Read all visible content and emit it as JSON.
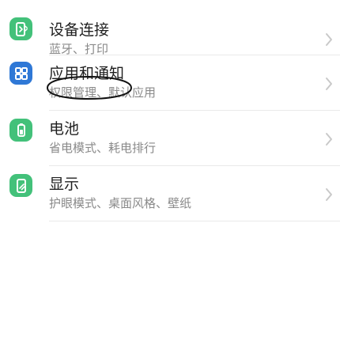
{
  "settings": {
    "items": [
      {
        "title": "设备连接",
        "subtitle": "蓝牙、打印",
        "icon": "device-connection-icon",
        "icon_color": "#43c17a"
      },
      {
        "title": "应用和通知",
        "subtitle": "权限管理、默认应用",
        "icon": "apps-grid-icon",
        "icon_color": "#2f78d6"
      },
      {
        "title": "电池",
        "subtitle": "省电模式、耗电排行",
        "icon": "battery-icon",
        "icon_color": "#43c17a"
      },
      {
        "title": "显示",
        "subtitle": "护眼模式、桌面风格、壁纸",
        "icon": "display-icon",
        "icon_color": "#43c17a"
      }
    ]
  },
  "colors": {
    "green": "#43c17a",
    "blue": "#2f78d6",
    "title_text": "#1f1f1f",
    "subtitle_text": "#8a8a8a",
    "chevron": "#c9c9c9",
    "divider": "#e9e9e9"
  }
}
